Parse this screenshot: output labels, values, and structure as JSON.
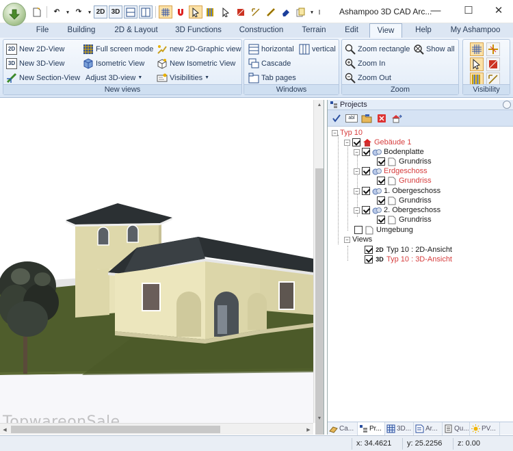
{
  "window": {
    "title": "Ashampoo 3D CAD Arc...",
    "minimize": "—",
    "maximize": "☐",
    "close": "✕"
  },
  "qat": {
    "btn_2d": "2D",
    "btn_3d": "3D"
  },
  "tabs": [
    "File",
    "Building",
    "2D & Layout",
    "3D Functions",
    "Construction",
    "Terrain",
    "Edit",
    "View",
    "Help",
    "My Ashampoo"
  ],
  "active_tab": "View",
  "ribbon": {
    "new_views": {
      "label": "New views",
      "new_2d_view": "New 2D-View",
      "new_3d_view": "New 3D-View",
      "new_section_view": "New Section-View",
      "full_screen_mode": "Full screen mode",
      "isometric_view": "Isometric View",
      "adjust_3d_view": "Adjust 3D-view",
      "new_2d_graphic_view": "new 2D-Graphic view",
      "new_isometric_view": "New Isometric View",
      "visibilities": "Visibilities"
    },
    "windows": {
      "label": "Windows",
      "horizontal": "horizontal",
      "vertical": "vertical",
      "cascade": "Cascade",
      "tab_pages": "Tab pages"
    },
    "zoom": {
      "label": "Zoom",
      "zoom_rectangle": "Zoom rectangle",
      "show_all": "Show all",
      "zoom_in": "Zoom In",
      "zoom_out": "Zoom Out"
    },
    "visibility": {
      "label": "Visibility"
    }
  },
  "viewport": {
    "watermark": "TopwareonSale"
  },
  "projects": {
    "title": "Projects",
    "tree": [
      {
        "label": "Typ 10",
        "red": true
      },
      {
        "label": "Gebäude 1",
        "red": true
      },
      {
        "label": "Bodenplatte",
        "red": false
      },
      {
        "label": "Grundriss",
        "red": false
      },
      {
        "label": "Erdgeschoss",
        "red": true
      },
      {
        "label": "Grundriss",
        "red": true
      },
      {
        "label": "1. Obergeschoss",
        "red": false
      },
      {
        "label": "Grundriss",
        "red": false
      },
      {
        "label": "2. Obergeschoss",
        "red": false
      },
      {
        "label": "Grundriss",
        "red": false
      },
      {
        "label": "Umgebung",
        "red": false
      },
      {
        "label": "Views",
        "red": false
      },
      {
        "label": "Typ 10 : 2D-Ansicht",
        "red": false,
        "badge": "2D"
      },
      {
        "label": "Typ 10 : 3D-Ansicht",
        "red": true,
        "badge": "3D"
      }
    ],
    "bottom_tabs": [
      "Ca...",
      "Pr...",
      "3D...",
      "Ar...",
      "Qu...",
      "PV..."
    ]
  },
  "status": {
    "x": "x: 34.4621",
    "y": "y: 25.2256",
    "z": "z: 0.00"
  },
  "colors": {
    "ribbon_bg": "#dce6f3",
    "tree_red": "#d63d3d",
    "wall": "#e8e2b8",
    "roof": "#2b3033",
    "lawn": "#4f5d2c"
  }
}
